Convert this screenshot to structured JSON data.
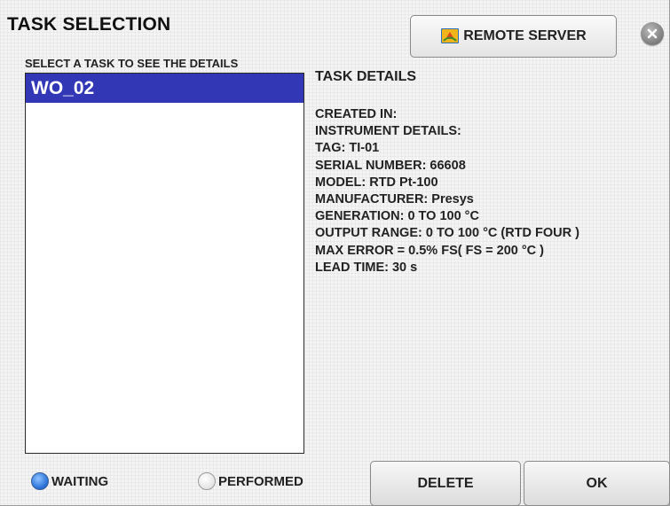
{
  "window": {
    "title": "TASK SELECTION",
    "close_icon": "close-icon"
  },
  "toolbar": {
    "remote_server_label": "REMOTE SERVER",
    "remote_server_icon": "server-sync-icon"
  },
  "task_list": {
    "label": "SELECT A TASK TO SEE THE DETAILS",
    "items": [
      {
        "label": "WO_02",
        "selected": true
      }
    ]
  },
  "details": {
    "heading": "TASK DETAILS",
    "lines": [
      "CREATED IN:",
      "INSTRUMENT DETAILS:",
      "TAG: TI-01",
      "SERIAL NUMBER: 66608",
      "MODEL: RTD Pt-100",
      "MANUFACTURER: Presys",
      "GENERATION: 0 TO 100 °C",
      "OUTPUT RANGE: 0 TO 100 °C (RTD FOUR )",
      "MAX ERROR = 0.5% FS( FS = 200 °C )",
      "LEAD TIME: 30 s"
    ]
  },
  "filters": {
    "waiting_label": "WAITING",
    "waiting_selected": true,
    "performed_label": "PERFORMED",
    "performed_selected": false
  },
  "actions": {
    "delete_label": "DELETE",
    "ok_label": "OK"
  },
  "colors": {
    "selection": "#3137b5",
    "radio_active": "#2a73d8"
  }
}
